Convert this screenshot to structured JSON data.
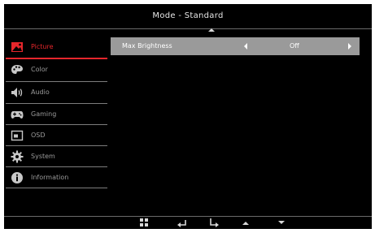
{
  "header": {
    "title": "Mode - Standard"
  },
  "menu": {
    "items": [
      {
        "label": "Picture",
        "icon": "picture-icon",
        "active": true
      },
      {
        "label": "Color",
        "icon": "palette-icon",
        "active": false
      },
      {
        "label": "Audio",
        "icon": "speaker-icon",
        "active": false
      },
      {
        "label": "Gaming",
        "icon": "gamepad-icon",
        "active": false
      },
      {
        "label": "OSD",
        "icon": "osd-icon",
        "active": false
      },
      {
        "label": "System",
        "icon": "gear-icon",
        "active": false
      },
      {
        "label": "Information",
        "icon": "info-icon",
        "active": false
      }
    ]
  },
  "settings": {
    "rows": [
      {
        "name": "Max Brightness",
        "value": "Off"
      }
    ]
  },
  "footer": {
    "keys": [
      "menu-grid-icon",
      "back-icon",
      "enter-icon",
      "up-icon",
      "down-icon"
    ]
  },
  "colors": {
    "accent": "#e5262b",
    "highlight_row": "#9a9a9a",
    "background": "#000000"
  }
}
